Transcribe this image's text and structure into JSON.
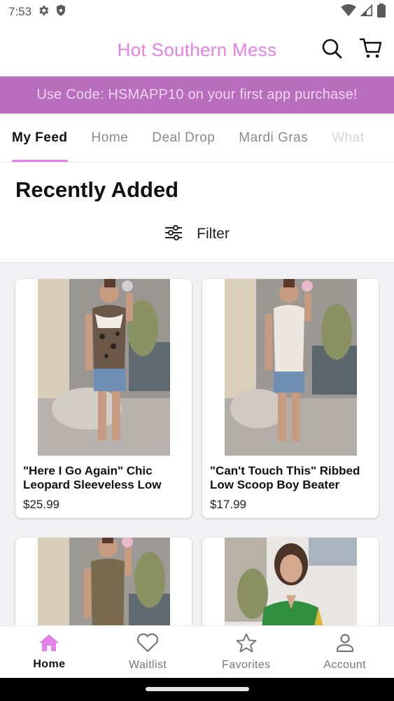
{
  "status_bar": {
    "time": "7:53"
  },
  "header": {
    "title": "Hot Southern Mess"
  },
  "promo": {
    "text": "Use Code: HSMAPP10 on your first app purchase!"
  },
  "tabs": [
    {
      "label": "My Feed",
      "active": true
    },
    {
      "label": "Home"
    },
    {
      "label": "Deal Drop"
    },
    {
      "label": "Mardi Gras"
    },
    {
      "label": "What"
    }
  ],
  "section": {
    "title": "Recently Added",
    "filter_label": "Filter"
  },
  "products": [
    {
      "name": "\"Here I Go Again\" Chic Leopard Sleeveless Low",
      "price": "$25.99"
    },
    {
      "name": "\"Can't Touch This\" Ribbed Low Scoop Boy Beater",
      "price": "$17.99"
    },
    {
      "name": "",
      "price": ""
    },
    {
      "name": "",
      "price": ""
    }
  ],
  "bottom_nav": [
    {
      "label": "Home",
      "icon": "home-icon",
      "active": true
    },
    {
      "label": "Waitlist",
      "icon": "heart-icon"
    },
    {
      "label": "Favorites",
      "icon": "star-icon"
    },
    {
      "label": "Account",
      "icon": "person-icon"
    }
  ],
  "colors": {
    "brand_pink": "#e580e8",
    "promo_bg": "#b86dbd",
    "promo_text": "#ecd6ee"
  }
}
